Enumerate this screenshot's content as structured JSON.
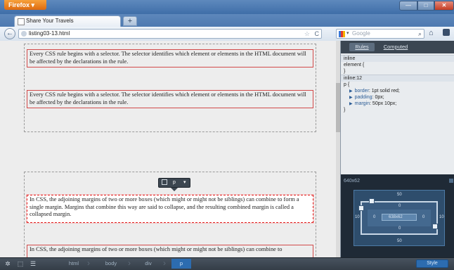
{
  "window": {
    "app_button": "Firefox ▾",
    "min_glyph": "—",
    "max_glyph": "□",
    "close_glyph": "✕"
  },
  "tabs": [
    {
      "title": "Share Your Travels"
    }
  ],
  "newtab_glyph": "+",
  "nav": {
    "back_glyph": "←",
    "url": "listing03-13.html",
    "url_star": "☆",
    "url_reload": "C",
    "search_placeholder": "Google",
    "search_caret": "▾",
    "search_icon": "⌕",
    "home_glyph": "⌂"
  },
  "content": {
    "paragraph_1": "Every CSS rule begins with a selector. The selector identifies which element or elements in the HTML document will be affected by the declarations in the rule.",
    "paragraph_2": "Every CSS rule begins with a selector. The selector identifies which element or elements in the HTML document will be affected by the declarations in the rule.",
    "paragraph_3": "In CSS, the adjoining margins of two or more boxes (which might or might not be siblings) can combine to form a single margin. Margins that combine this way are said to collapse, and the resulting combined margin is called a collapsed margin.",
    "paragraph_4": "In CSS, the adjoining margins of two or more boxes (which might or might not be siblings) can combine to",
    "infobar_tag": "p",
    "infobar_caret": "▾"
  },
  "style_panel": {
    "tabs": {
      "rules": "Rules",
      "computed": "Computed"
    },
    "lines": {
      "inline_source": "inline",
      "element_open": "element {",
      "element_close": "}",
      "rule_source": "inline:12",
      "p_open": "p {",
      "close": "}"
    },
    "properties": [
      {
        "name": "border",
        "value": "1pt solid red;"
      },
      {
        "name": "padding",
        "value": "0px;"
      },
      {
        "name": "margin",
        "value": "50px 10px;"
      }
    ],
    "prop_arrow": "▶"
  },
  "layout_view": {
    "dims": "640x62",
    "margin_top": "50",
    "margin_bottom": "50",
    "margin_left": "10",
    "margin_right": "10",
    "border_top": "1",
    "border_bottom": "1",
    "border_left": "1",
    "border_right": "1",
    "padding_top": "0",
    "padding_bottom": "0",
    "padding_left": "0",
    "padding_right": "0",
    "content_size": "638x62"
  },
  "devtools": {
    "gear_glyph": "✲",
    "inspect_glyph": "⬚",
    "markup_glyph": "☰",
    "breadcrumbs": [
      "html",
      "body",
      "div",
      "p"
    ],
    "crumb_sep": "›",
    "style_button": "Style"
  },
  "colors": {
    "accent": "#2c6cb0",
    "selection_border": "#e02020",
    "firefox_orange": "#dd6a0f"
  }
}
